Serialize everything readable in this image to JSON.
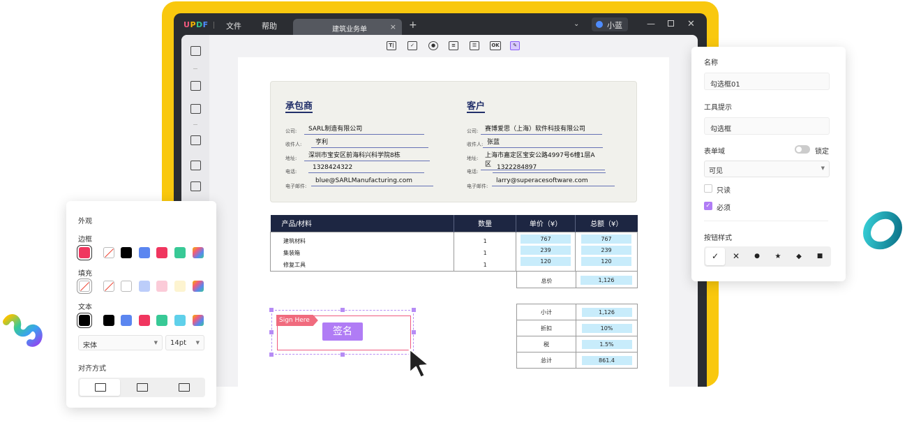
{
  "titlebar": {
    "logo": {
      "u": "U",
      "p": "P",
      "d": "D",
      "f": "F"
    },
    "menus": [
      "文件",
      "帮助"
    ],
    "tab_title": "建筑业务单",
    "tab_close": "×",
    "new_tab": "+",
    "user_name": "小蓝",
    "window_min": "—",
    "window_close": "✕"
  },
  "toolbar_icons": [
    {
      "name": "text-field-icon",
      "glyph": "T|"
    },
    {
      "name": "checkbox-icon",
      "glyph": "✓"
    },
    {
      "name": "radio-button-icon",
      "glyph": "●"
    },
    {
      "name": "dropdown-field-icon",
      "glyph": "≡"
    },
    {
      "name": "list-box-icon",
      "glyph": "☰"
    },
    {
      "name": "button-field-icon",
      "glyph": "OK"
    },
    {
      "name": "signature-field-icon",
      "glyph": "✎"
    }
  ],
  "document": {
    "contractor": {
      "title": "承包商",
      "fields": [
        {
          "label": "公司:",
          "value": "SARL制造有限公司"
        },
        {
          "label": "收件人:",
          "value": "亨利"
        },
        {
          "label": "地址:",
          "value": "深圳市宝安区前海科兴科学院8栋"
        },
        {
          "label": "电话:",
          "value": "1328424322"
        },
        {
          "label": "电子邮件:",
          "value": "blue@SARLManufacturing.com"
        }
      ]
    },
    "customer": {
      "title": "客户",
      "fields": [
        {
          "label": "公司:",
          "value": "赛博爱思（上海）软件科技有限公司"
        },
        {
          "label": "收件人:",
          "value": "张蓝"
        },
        {
          "label": "地址:",
          "value": "上海市嘉定区宝安公路4997号6幢1层A区"
        },
        {
          "label": "电话:",
          "value": "1322284897"
        },
        {
          "label": "电子邮件:",
          "value": "larry@superacesoftware.com"
        }
      ]
    },
    "table": {
      "headers": [
        "产品/材料",
        "数量",
        "单价（¥）",
        "总额（¥）"
      ],
      "rows": [
        {
          "item": "建筑材料",
          "qty": "1",
          "price": "767",
          "total": "767"
        },
        {
          "item": "集装箱",
          "qty": "1",
          "price": "239",
          "total": "239"
        },
        {
          "item": "修复工具",
          "qty": "1",
          "price": "120",
          "total": "120"
        }
      ],
      "total_label": "总价",
      "total_value": "1,126"
    },
    "summary": [
      {
        "label": "小计",
        "value": "1,126"
      },
      {
        "label": "折扣",
        "value": "10%"
      },
      {
        "label": "税",
        "value": "1.5%"
      },
      {
        "label": "总计",
        "value": "861.4"
      }
    ],
    "signature": {
      "flag": "Sign Here",
      "button": "签名"
    }
  },
  "appearance_panel": {
    "title": "外观",
    "border_label": "边框",
    "fill_label": "填充",
    "text_label": "文本",
    "font": "宋体",
    "font_size": "14pt",
    "align_label": "对齐方式",
    "colors": {
      "red": "#f0365f",
      "black": "#000000",
      "blue": "#5b86f0",
      "green": "#38c996",
      "light_blue": "#bccdfa",
      "pink": "#fbcbd8",
      "cream": "#fdf4d0",
      "cyan": "#5fd0ea"
    }
  },
  "properties_panel": {
    "name_label": "名称",
    "name_value": "勾选框01",
    "tooltip_label": "工具提示",
    "tooltip_value": "勾选框",
    "form_field_label": "表单域",
    "lock_label": "锁定",
    "visibility": "可见",
    "readonly_label": "只读",
    "required_label": "必须",
    "required_check": "✓",
    "button_style_label": "按钮样式",
    "styles": [
      "✓",
      "✕",
      "●",
      "★",
      "◆",
      "■"
    ]
  },
  "accent_color": "#b07cf5"
}
